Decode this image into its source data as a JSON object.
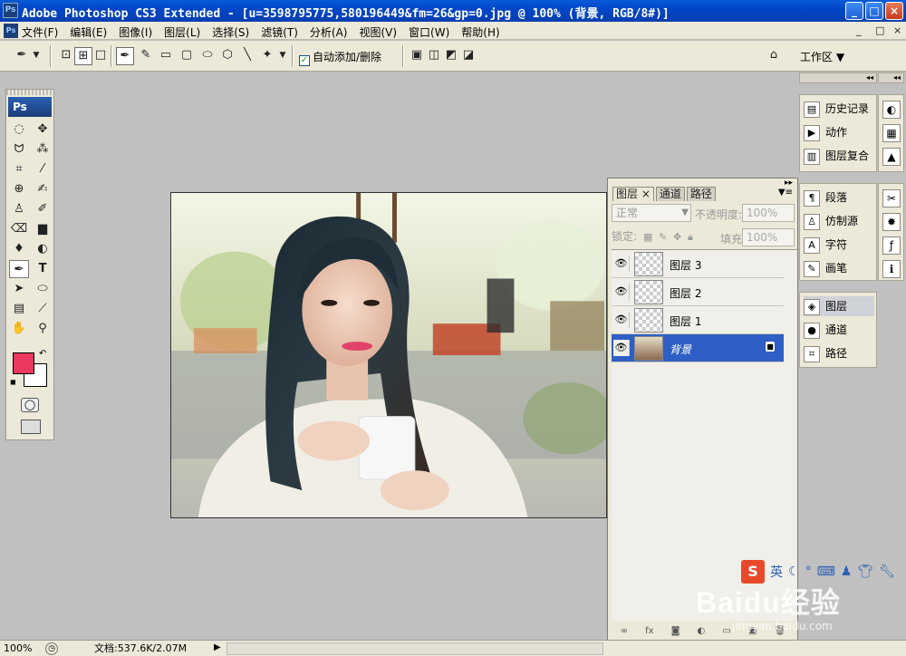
{
  "window": {
    "app_icon": "Ps",
    "title": "Adobe Photoshop CS3 Extended - [u=3598795775,580196449&fm=26&gp=0.jpg @ 100% (背景, RGB/8#)]",
    "min_symbol": "_",
    "max_symbol": "□",
    "close_symbol": "×"
  },
  "menubar": {
    "items": [
      "文件(F)",
      "编辑(E)",
      "图像(I)",
      "图层(L)",
      "选择(S)",
      "滤镜(T)",
      "分析(A)",
      "视图(V)",
      "窗口(W)",
      "帮助(H)"
    ],
    "mdi_min": "_",
    "mdi_restore": "□",
    "mdi_close": "×"
  },
  "options_bar": {
    "auto_add_delete_label": "自动添加/删除",
    "auto_add_delete_checked": true,
    "workspace_label": "工作区 ▼"
  },
  "toolbox": {
    "header": "Ps",
    "foreground_color": "#ea3860",
    "background_color": "#ffffff",
    "tools": [
      "marquee-icon",
      "move-icon",
      "lasso-icon",
      "magic-wand-icon",
      "crop-icon",
      "slice-icon",
      "healing-icon",
      "brush-icon",
      "stamp-icon",
      "history-brush-icon",
      "eraser-icon",
      "gradient-icon",
      "blur-icon",
      "dodge-icon",
      "pen-icon",
      "type-icon",
      "path-select-icon",
      "shape-icon",
      "notes-icon",
      "eyedropper-icon",
      "hand-icon",
      "zoom-icon"
    ]
  },
  "layers_panel": {
    "tabs": [
      "图层 ×",
      "通道",
      "路径"
    ],
    "blend_mode": "正常",
    "opacity_label": "不透明度:",
    "opacity_value": "100%",
    "lock_label": "锁定:",
    "fill_label": "填充:",
    "fill_value": "100%",
    "layers": [
      {
        "name": "图层 3",
        "visible": true,
        "active": false
      },
      {
        "name": "图层 2",
        "visible": true,
        "active": false
      },
      {
        "name": "图层 1",
        "visible": true,
        "active": false
      },
      {
        "name": "背景",
        "visible": true,
        "active": true,
        "locked": true
      }
    ]
  },
  "dock": {
    "group1": [
      "历史记录",
      "动作",
      "图层复合"
    ],
    "group2": [
      "段落",
      "仿制源",
      "字符",
      "画笔"
    ],
    "group3": [
      "图层",
      "通道",
      "路径"
    ]
  },
  "statusbar": {
    "zoom": "100%",
    "doc_info": "文档:537.6K/2.07M"
  },
  "watermark": {
    "brand": "Baidu经验",
    "url": "jingyan.baidu.com"
  },
  "colors": {
    "title_blue": "#0046c8",
    "chrome": "#ece9d8",
    "selected_layer": "#2f5fc4",
    "canvas_bg": "#c0c0c0"
  }
}
